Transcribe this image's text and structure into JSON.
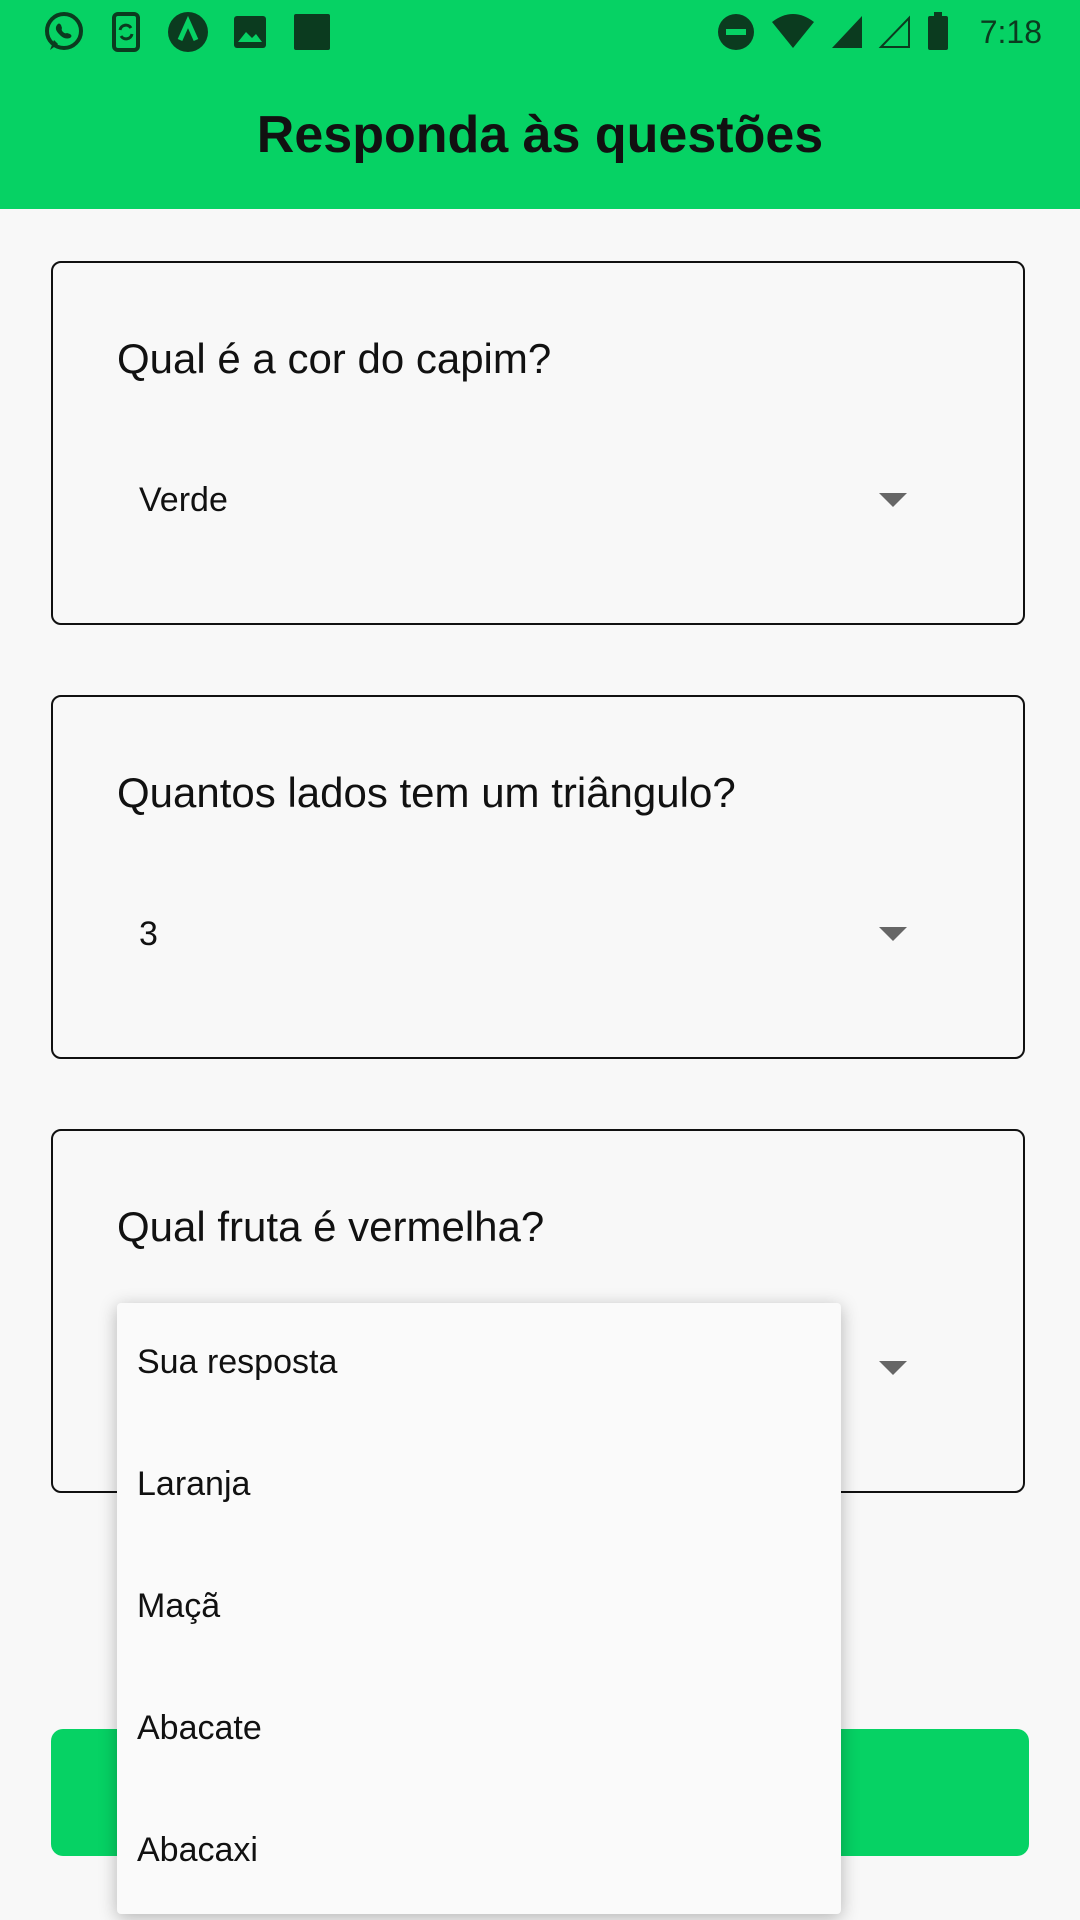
{
  "status_bar": {
    "time": "7:18",
    "left_icons": [
      "whatsapp-icon",
      "phone-sync-icon",
      "app-lambda-icon",
      "image-icon",
      "square-icon"
    ],
    "right_icons": [
      "dnd-icon",
      "wifi-icon",
      "signal-icon",
      "signal-empty-icon",
      "battery-icon"
    ]
  },
  "app_bar": {
    "title": "Responda às questões",
    "color": "#06d264"
  },
  "questions": [
    {
      "question": "Qual é a cor do capim?",
      "selected": "Verde"
    },
    {
      "question": "Quantos lados tem um triângulo?",
      "selected": "3"
    },
    {
      "question": "Qual fruta é vermelha?",
      "selected": ""
    }
  ],
  "dropdown": {
    "options": [
      "Sua resposta",
      "Laranja",
      "Maçã",
      "Abacate",
      "Abacaxi"
    ]
  },
  "submit_button": {
    "label": "",
    "color": "#06d264"
  }
}
